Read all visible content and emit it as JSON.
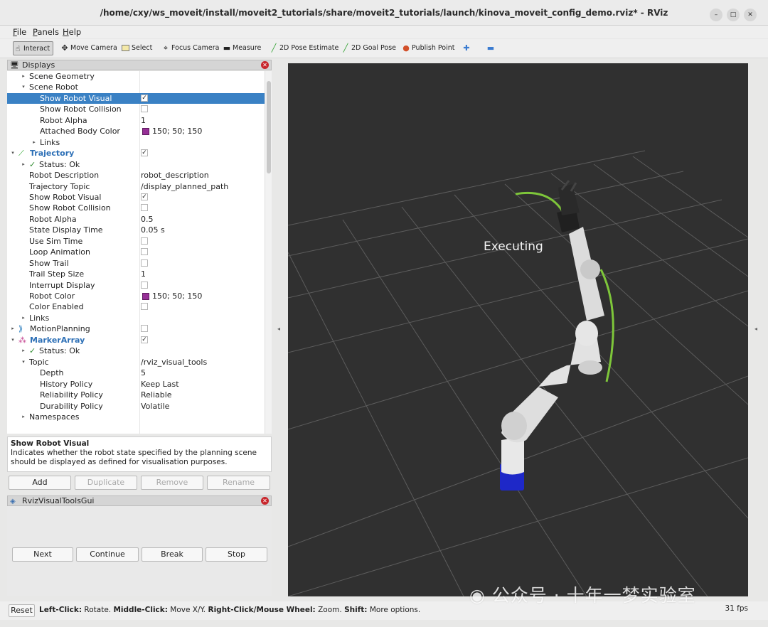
{
  "window": {
    "title": "/home/cxy/ws_moveit/install/moveit2_tutorials/share/moveit2_tutorials/launch/kinova_moveit_config_demo.rviz* - RViz"
  },
  "menu": [
    "File",
    "Panels",
    "Help"
  ],
  "toolbar": {
    "interact": "Interact",
    "move_camera": "Move Camera",
    "select": "Select",
    "focus_camera": "Focus Camera",
    "measure": "Measure",
    "pose_estimate": "2D Pose Estimate",
    "goal_pose": "2D Goal Pose",
    "publish_point": "Publish Point"
  },
  "displays": {
    "title": "Displays",
    "rows": [
      {
        "label": "Scene Geometry"
      },
      {
        "label": "Scene Robot"
      },
      {
        "label": "Show Robot Visual",
        "checked": true
      },
      {
        "label": "Show Robot Collision",
        "checked": false
      },
      {
        "label": "Robot Alpha",
        "value": "1"
      },
      {
        "label": "Attached Body Color",
        "value": "150; 50; 150"
      },
      {
        "label": "Links"
      },
      {
        "label": "Trajectory",
        "checked": true
      },
      {
        "label": "Status: Ok"
      },
      {
        "label": "Robot Description",
        "value": "robot_description"
      },
      {
        "label": "Trajectory Topic",
        "value": "/display_planned_path"
      },
      {
        "label": "Show Robot Visual",
        "checked": true
      },
      {
        "label": "Show Robot Collision",
        "checked": false
      },
      {
        "label": "Robot Alpha",
        "value": "0.5"
      },
      {
        "label": "State Display Time",
        "value": "0.05 s"
      },
      {
        "label": "Use Sim Time",
        "checked": false
      },
      {
        "label": "Loop Animation",
        "checked": false
      },
      {
        "label": "Show Trail",
        "checked": false
      },
      {
        "label": "Trail Step Size",
        "value": "1"
      },
      {
        "label": "Interrupt Display",
        "checked": false
      },
      {
        "label": "Robot Color",
        "value": "150; 50; 150"
      },
      {
        "label": "Color Enabled",
        "checked": false
      },
      {
        "label": "Links"
      },
      {
        "label": "MotionPlanning",
        "checked": false
      },
      {
        "label": "MarkerArray",
        "checked": true
      },
      {
        "label": "Status: Ok"
      },
      {
        "label": "Topic",
        "value": "/rviz_visual_tools"
      },
      {
        "label": "Depth",
        "value": "5"
      },
      {
        "label": "History Policy",
        "value": "Keep Last"
      },
      {
        "label": "Reliability Policy",
        "value": "Reliable"
      },
      {
        "label": "Durability Policy",
        "value": "Volatile"
      },
      {
        "label": "Namespaces"
      }
    ],
    "description_title": "Show Robot Visual",
    "description_text": "Indicates whether the robot state specified by the planning scene should be displayed as defined for visualisation purposes.",
    "buttons": {
      "add": "Add",
      "duplicate": "Duplicate",
      "remove": "Remove",
      "rename": "Rename"
    }
  },
  "rviz_gui": {
    "title": "RvizVisualToolsGui",
    "buttons": {
      "next": "Next",
      "continue": "Continue",
      "break": "Break",
      "stop": "Stop"
    }
  },
  "viewport": {
    "overlay_text": "Executing"
  },
  "status": {
    "reset": "Reset",
    "left_click_key": "Left-Click:",
    "left_click_val": "Rotate.",
    "middle_click_key": "Middle-Click:",
    "middle_click_val": "Move X/Y.",
    "right_click_key": "Right-Click/Mouse Wheel:",
    "right_click_val": "Zoom.",
    "shift_key": "Shift:",
    "shift_val": "More options.",
    "fps": "31 fps"
  },
  "watermark": "公众号 · 十年一梦实验室",
  "colors": {
    "selection": "#3a81c4",
    "swatch": "#962f96",
    "trajectory_line": "#7ec63a",
    "viewport_bg": "#303030",
    "robot_base": "#1e28c8"
  }
}
